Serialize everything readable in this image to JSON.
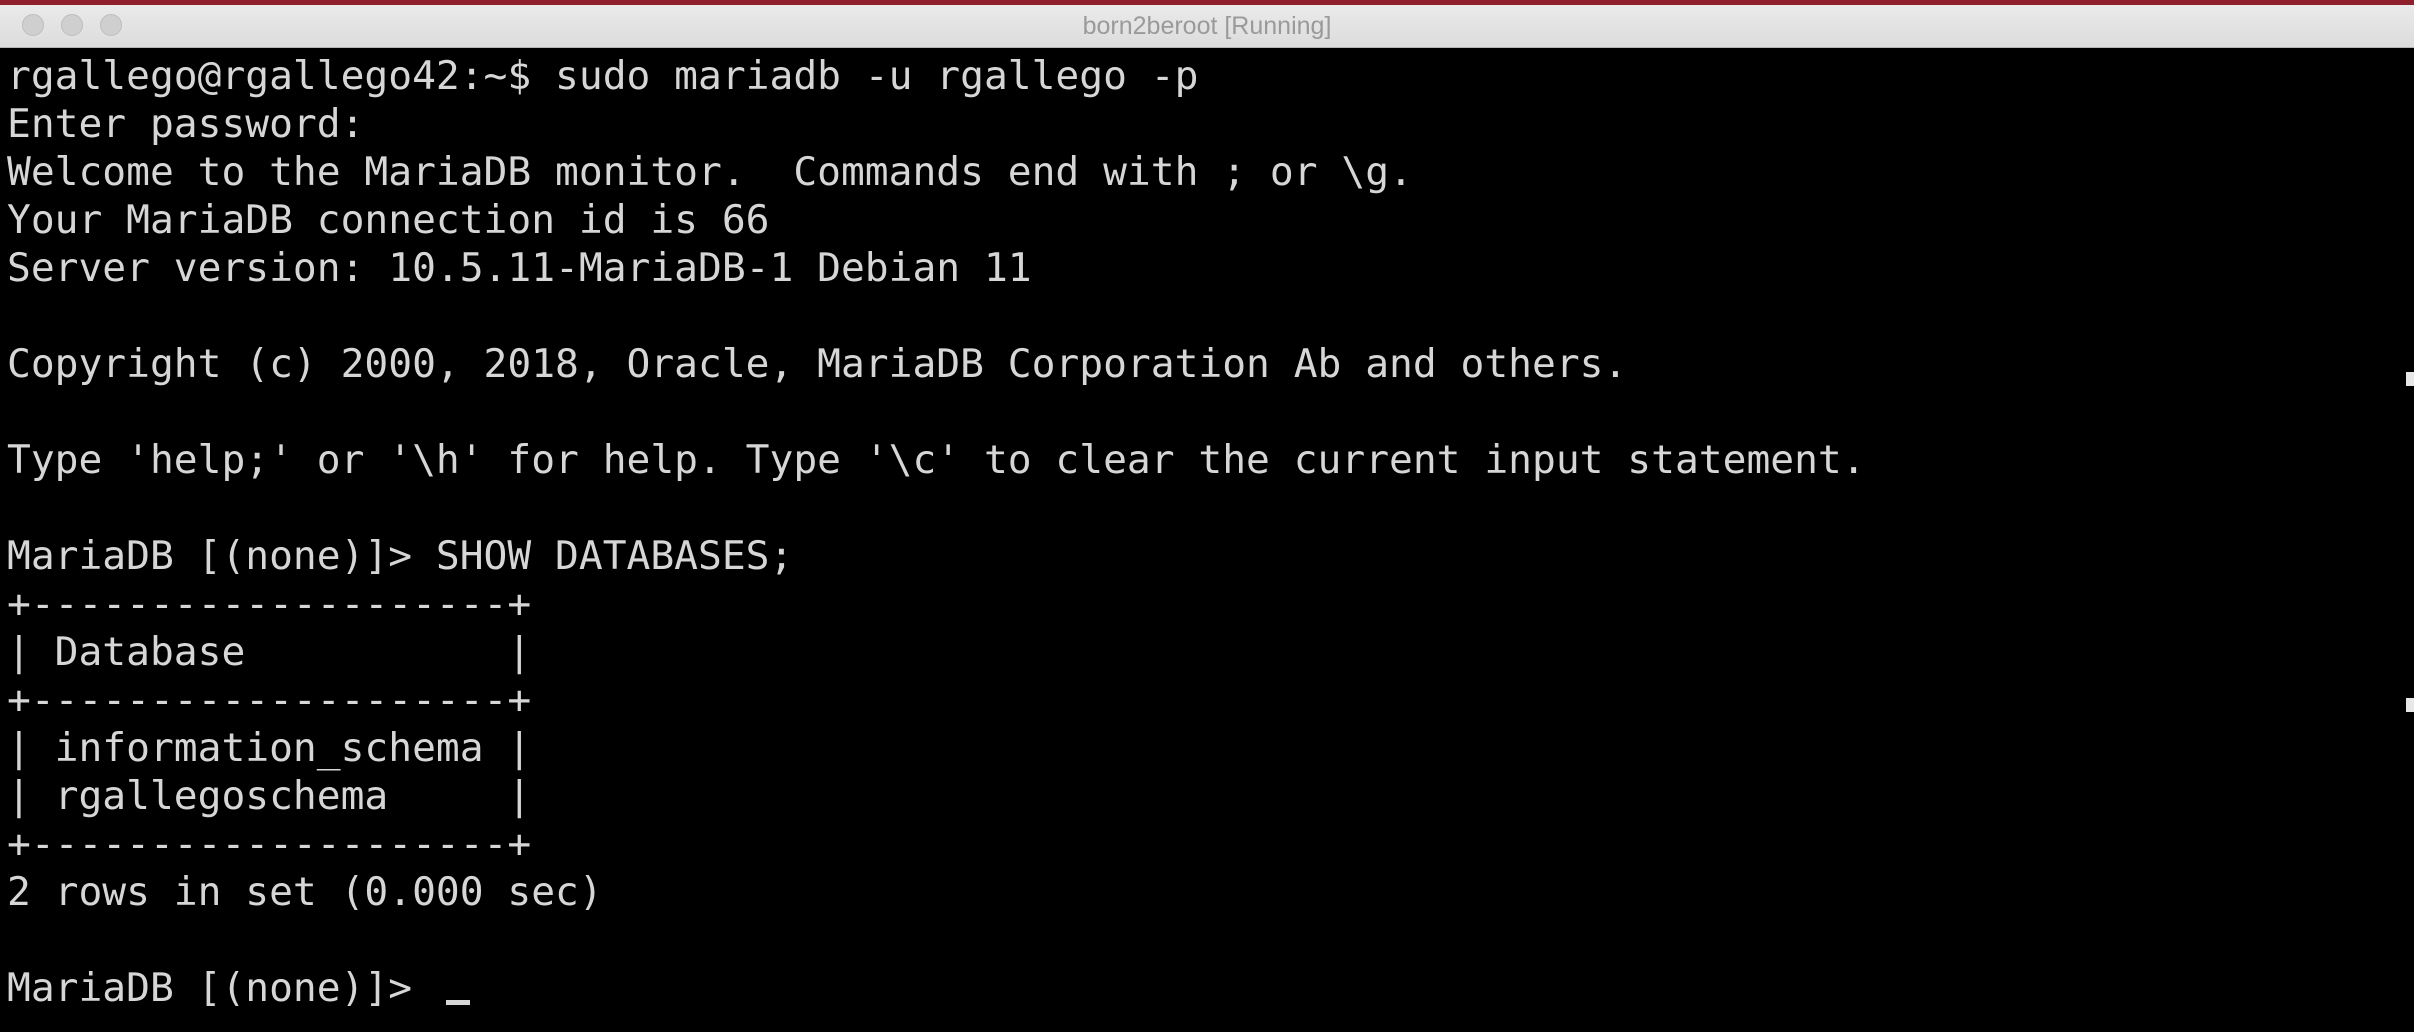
{
  "window": {
    "title": "born2beroot [Running]"
  },
  "terminal": {
    "lines": [
      "rgallego@rgallego42:~$ sudo mariadb -u rgallego -p",
      "Enter password:",
      "Welcome to the MariaDB monitor.  Commands end with ; or \\g.",
      "Your MariaDB connection id is 66",
      "Server version: 10.5.11-MariaDB-1 Debian 11",
      "",
      "Copyright (c) 2000, 2018, Oracle, MariaDB Corporation Ab and others.",
      "",
      "Type 'help;' or '\\h' for help. Type '\\c' to clear the current input statement.",
      "",
      "MariaDB [(none)]> SHOW DATABASES;",
      "+--------------------+",
      "| Database           |",
      "+--------------------+",
      "| information_schema |",
      "| rgallegoschema     |",
      "+--------------------+",
      "2 rows in set (0.000 sec)",
      ""
    ],
    "prompt": "MariaDB [(none)]> "
  },
  "colors": {
    "background": "#000000",
    "text": "#d6d6d6",
    "titlebar": "#e4e4e4",
    "accent": "#8f1f2b"
  }
}
